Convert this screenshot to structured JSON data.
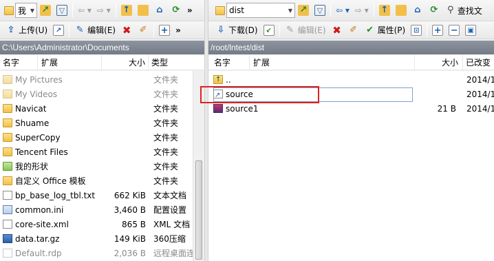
{
  "left": {
    "toolbar1": {
      "location_value": "我",
      "more_glyph": "»"
    },
    "toolbar2": {
      "upload_label": "上传(U)",
      "edit_label": "编辑(E)",
      "more_glyph": "»"
    },
    "path": "C:\\Users\\Administrator\\Documents",
    "columns": {
      "name": "名字",
      "ext": "扩展",
      "size": "大小",
      "type": "类型"
    },
    "files": [
      {
        "name": "My Pictures",
        "size": "",
        "type": "文件夹"
      },
      {
        "name": "My Videos",
        "size": "",
        "type": "文件夹"
      },
      {
        "name": "Navicat",
        "size": "",
        "type": "文件夹"
      },
      {
        "name": "Shuame",
        "size": "",
        "type": "文件夹"
      },
      {
        "name": "SuperCopy",
        "size": "",
        "type": "文件夹"
      },
      {
        "name": "Tencent Files",
        "size": "",
        "type": "文件夹"
      },
      {
        "name": "我的形状",
        "size": "",
        "type": "文件夹"
      },
      {
        "name": "自定义 Office 模板",
        "size": "",
        "type": "文件夹"
      },
      {
        "name": "bp_base_log_tbl.txt",
        "size": "662 KiB",
        "type": "文本文档"
      },
      {
        "name": "common.ini",
        "size": "3,460 B",
        "type": "配置设置"
      },
      {
        "name": "core-site.xml",
        "size": "865 B",
        "type": "XML 文档"
      },
      {
        "name": "data.tar.gz",
        "size": "149 KiB",
        "type": "360压缩"
      },
      {
        "name": "Default.rdp",
        "size": "2,036 B",
        "type": "远程桌面连"
      }
    ]
  },
  "right": {
    "toolbar1": {
      "location_value": "dist",
      "find_label": "查找文"
    },
    "toolbar2": {
      "download_label": "下载(D)",
      "edit_label": "编辑(E)",
      "properties_label": "属性(P)"
    },
    "path": "/root/lntest/dist",
    "columns": {
      "name": "名字",
      "ext": "扩展",
      "size": "大小",
      "modified": "已改变"
    },
    "files": [
      {
        "name": "..",
        "size": "",
        "modified": "2014/1"
      },
      {
        "name": "source",
        "size": "",
        "modified": "2014/1"
      },
      {
        "name": "source1",
        "size": "21 B",
        "modified": "2014/1"
      }
    ]
  },
  "icons": {
    "folder": "folder-icon",
    "file": "file-icon",
    "symlink": "symlink-icon"
  },
  "colors": {
    "path_bar": "#7d8591",
    "highlight_box": "#e02020",
    "selection_border": "#7da2ce"
  }
}
